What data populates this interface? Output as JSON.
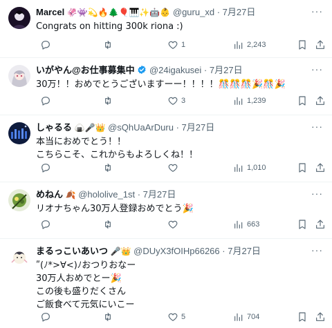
{
  "tweets": [
    {
      "name": "Marcel",
      "emojis": "🦑👾💫🔥🌲🎈🎹✨🤖👶",
      "verified": false,
      "handle": "@guru_xd",
      "separator": "·",
      "time": "7月27日",
      "text": "Congrats on hitting 300k riona :)",
      "likes": "1",
      "views": "2,243",
      "reply_count": "",
      "retweet_count": ""
    },
    {
      "name": "いがやん@お仕事募集中",
      "emojis": "",
      "verified": true,
      "handle": "@24igakusei",
      "separator": "·",
      "time": "7月27日",
      "text": "30万！！おめでとうございますーー！！！！🎊🎊🎊🎉🎊🎉",
      "likes": "3",
      "views": "1,239",
      "reply_count": "",
      "retweet_count": ""
    },
    {
      "name": "しゃるる",
      "emojis": "🍙🎤👑",
      "verified": false,
      "handle": "@sQhUaArDuru",
      "separator": "·",
      "time": "7月27日",
      "text": "本当におめでとう！！\nこちらこそ、これからもよろしくね！！",
      "likes": "",
      "views": "1,010",
      "reply_count": "",
      "retweet_count": ""
    },
    {
      "name": "めねん",
      "emojis": "🍂",
      "verified": false,
      "handle": "@hololive_1st",
      "separator": "·",
      "time": "7月27日",
      "text": "リオナちゃん30万人登録おめでとう🎉",
      "likes": "",
      "views": "663",
      "reply_count": "",
      "retweet_count": ""
    },
    {
      "name": "まるっこいあいつ",
      "emojis": "🎤👑",
      "verified": false,
      "handle": "@DUyX3fOIHp66266",
      "separator": "·",
      "time": "7月27日",
      "text": "ʺ(ﾉ*>∀<)ﾉおつりおなー\n30万人おめでとー🎉\nこの後も盛りだくさん\nご飯食べて元気にいこー",
      "likes": "5",
      "views": "704",
      "reply_count": "",
      "retweet_count": ""
    }
  ],
  "icons": {
    "reply": "reply-icon",
    "retweet": "retweet-icon",
    "like": "heart-icon",
    "views": "views-icon",
    "bookmark": "bookmark-icon",
    "share": "share-icon",
    "more": "more-icon",
    "verified": "verified-badge-icon"
  },
  "colors": {
    "verified": "#1d9bf0",
    "muted": "#536471",
    "text": "#0f1419"
  }
}
